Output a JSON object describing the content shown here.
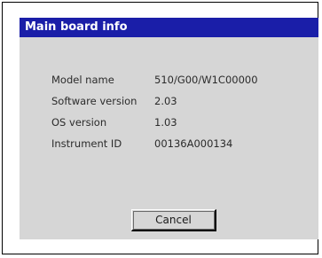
{
  "dialog": {
    "title": "Main board info",
    "rows": [
      {
        "label": "Model name",
        "value": "510/G00/W1C00000"
      },
      {
        "label": "Software version",
        "value": "2.03"
      },
      {
        "label": "OS version",
        "value": "1.03"
      },
      {
        "label": "Instrument ID",
        "value": "00136A000134"
      }
    ],
    "cancel_label": "Cancel"
  },
  "colors": {
    "titlebar": "#1a1ea8",
    "dialog_background": "#d6d6d6"
  }
}
